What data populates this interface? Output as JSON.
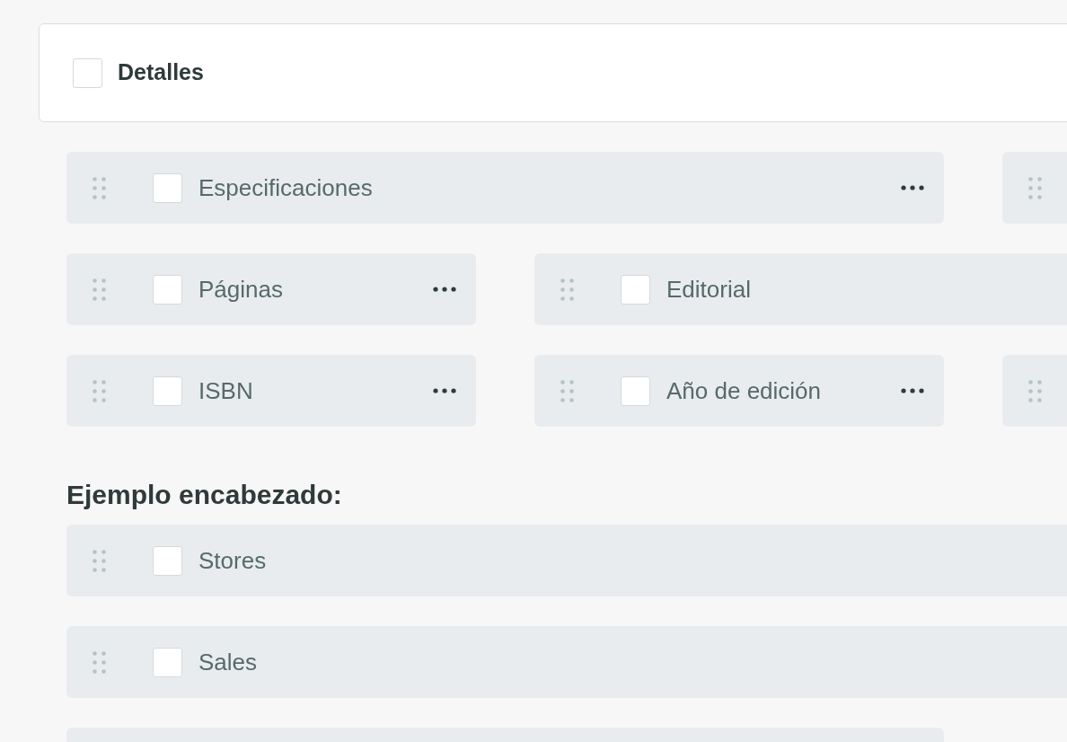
{
  "card": {
    "title": "Detalles",
    "checked": false
  },
  "sections": [
    {
      "rows": [
        [
          {
            "kind": "field",
            "label": "Especificaciones",
            "checked": false,
            "menu": true
          },
          {
            "kind": "stub"
          }
        ],
        [
          {
            "kind": "field",
            "label": "Páginas",
            "checked": false,
            "menu": true
          },
          {
            "kind": "field",
            "label": "Editorial",
            "checked": false,
            "menu": false
          }
        ],
        [
          {
            "kind": "field",
            "label": "ISBN",
            "checked": false,
            "menu": true
          },
          {
            "kind": "field",
            "label": "Año de edición",
            "checked": false,
            "menu": true
          },
          {
            "kind": "stub"
          }
        ]
      ]
    },
    {
      "heading": "Ejemplo encabezado:",
      "rows": [
        [
          {
            "kind": "field",
            "label": "Stores",
            "checked": false,
            "menu": false
          }
        ],
        [
          {
            "kind": "field",
            "label": "Sales",
            "checked": false,
            "menu": false
          }
        ],
        [
          {
            "kind": "blank"
          }
        ]
      ]
    }
  ]
}
